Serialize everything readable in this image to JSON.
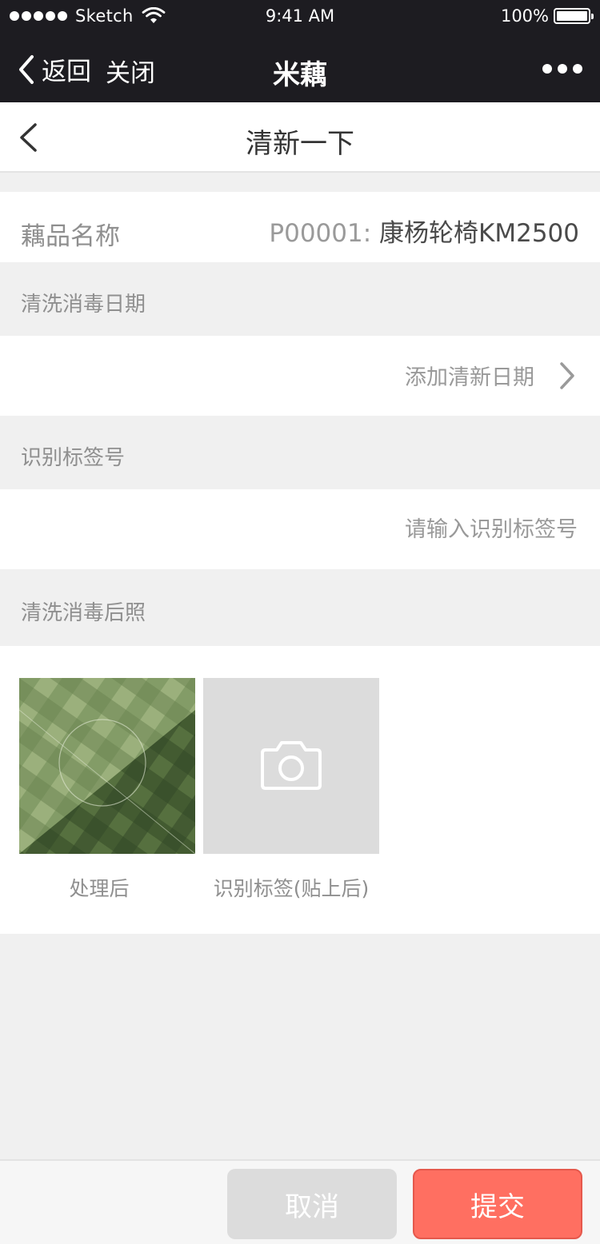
{
  "status_bar": {
    "carrier": "Sketch",
    "time": "9:41 AM",
    "battery": "100%"
  },
  "wechat_nav": {
    "back_label": "返回",
    "close_label": "关闭",
    "title": "米藕"
  },
  "page": {
    "title": "清新一下"
  },
  "product": {
    "label": "藕品名称",
    "code": "P00001:",
    "name": "康杨轮椅KM2500"
  },
  "sections": {
    "clean_date": "清洗消毒日期",
    "tag_number": "识别标签号",
    "photos": "清洗消毒后照"
  },
  "date_picker": {
    "placeholder": "添加清新日期"
  },
  "tag_input": {
    "value": "",
    "placeholder": "请输入识别标签号"
  },
  "photos": [
    {
      "caption": "处理后"
    },
    {
      "caption": "识别标签(贴上后)"
    }
  ],
  "actions": {
    "cancel": "取消",
    "submit": "提交"
  },
  "colors": {
    "nav_bg": "#1d1c21",
    "submit": "#ff6f61",
    "cancel": "#dcdcdc"
  }
}
